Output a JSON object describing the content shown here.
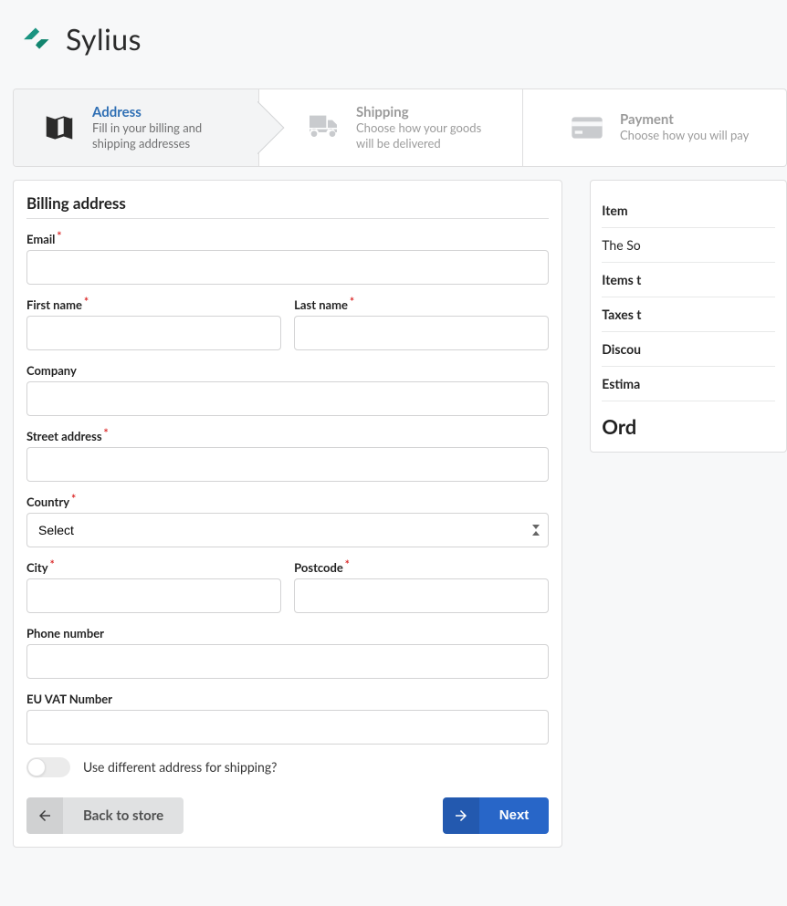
{
  "brand": {
    "name": "Sylius"
  },
  "steps": {
    "address": {
      "title": "Address",
      "desc": "Fill in your billing and shipping addresses"
    },
    "shipping": {
      "title": "Shipping",
      "desc": "Choose how your goods will be delivered"
    },
    "payment": {
      "title": "Payment",
      "desc": "Choose how you will pay"
    }
  },
  "form": {
    "section_title": "Billing address",
    "email_label": "Email",
    "first_name_label": "First name",
    "last_name_label": "Last name",
    "company_label": "Company",
    "street_label": "Street address",
    "country_label": "Country",
    "country_placeholder": "Select",
    "city_label": "City",
    "postcode_label": "Postcode",
    "phone_label": "Phone number",
    "vat_label": "EU VAT Number",
    "diff_shipping_label": "Use different address for shipping?"
  },
  "buttons": {
    "back_label": "Back to store",
    "next_label": "Next"
  },
  "summary": {
    "header_item": "Item",
    "line_item": "The So",
    "items_total": "Items t",
    "taxes": "Taxes t",
    "discount": "Discou",
    "estimated": "Estima",
    "order_total": "Ord"
  }
}
